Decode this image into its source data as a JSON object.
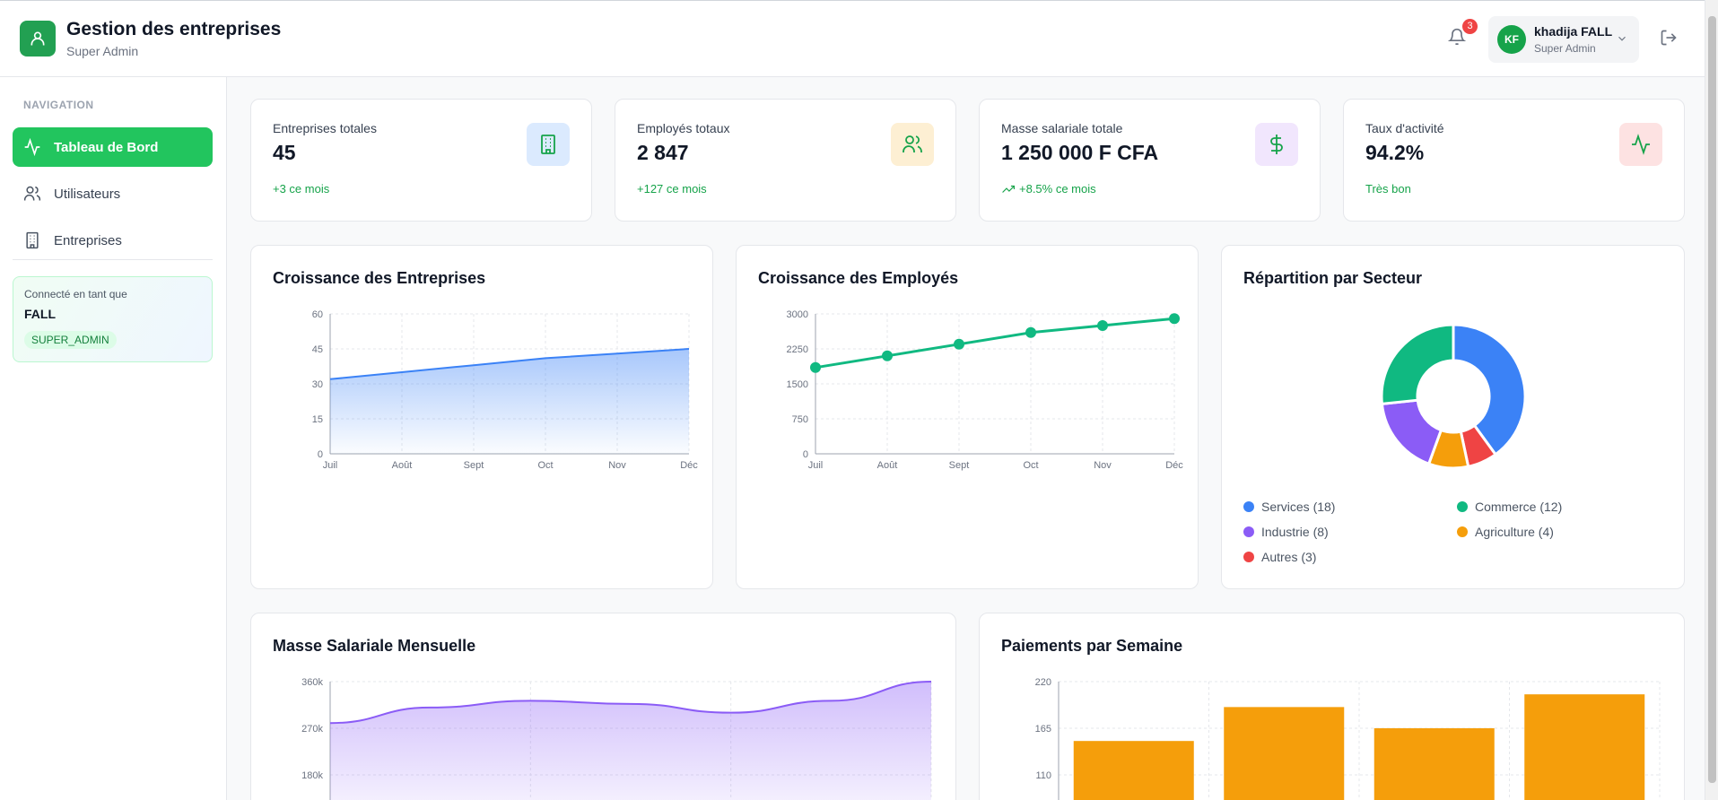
{
  "header": {
    "title": "Gestion des entreprises",
    "subtitle": "Super Admin",
    "notification_count": "3",
    "user": {
      "initials": "KF",
      "name": "khadija FALL",
      "role": "Super Admin"
    }
  },
  "sidebar": {
    "heading": "NAVIGATION",
    "items": [
      {
        "label": "Tableau de Bord",
        "icon": "activity-icon",
        "active": true
      },
      {
        "label": "Utilisateurs",
        "icon": "users-icon",
        "active": false
      },
      {
        "label": "Entreprises",
        "icon": "building-icon",
        "active": false
      }
    ],
    "connected": {
      "label": "Connecté en tant que",
      "name": "FALL",
      "role_badge": "SUPER_ADMIN"
    }
  },
  "stats": [
    {
      "label": "Entreprises totales",
      "value": "45",
      "delta": "+3 ce mois",
      "icon": "building-icon",
      "icon_bg": "#dbeafe",
      "icon_color": "#16a34a"
    },
    {
      "label": "Employés totaux",
      "value": "2 847",
      "delta": "+127 ce mois",
      "icon": "users-icon",
      "icon_bg": "#fdefd3",
      "icon_color": "#16a34a"
    },
    {
      "label": "Masse salariale totale",
      "value": "1 250 000 F CFA",
      "delta": "+8.5% ce mois",
      "icon": "dollar-icon",
      "icon_bg": "#f1e6fd",
      "icon_color": "#16a34a"
    },
    {
      "label": "Taux d'activité",
      "value": "94.2%",
      "delta": "Très bon",
      "icon": "activity-icon",
      "icon_bg": "#fde2e2",
      "icon_color": "#16a34a"
    }
  ],
  "charts": {
    "entreprises": {
      "title": "Croissance des Entreprises"
    },
    "employes": {
      "title": "Croissance des Employés"
    },
    "secteur": {
      "title": "Répartition par Secteur"
    },
    "masse": {
      "title": "Masse Salariale Mensuelle"
    },
    "paiements": {
      "title": "Paiements par Semaine"
    }
  },
  "chart_data": [
    {
      "type": "area",
      "title": "Croissance des Entreprises",
      "categories": [
        "Juil",
        "Août",
        "Sept",
        "Oct",
        "Nov",
        "Déc"
      ],
      "values": [
        32,
        35,
        38,
        41,
        43,
        45
      ],
      "ylim": [
        0,
        60
      ],
      "yticks": [
        "0",
        "15",
        "30",
        "45",
        "60"
      ],
      "color": "#3b82f6",
      "grid": true
    },
    {
      "type": "line",
      "title": "Croissance des Employés",
      "categories": [
        "Juil",
        "Août",
        "Sept",
        "Oct",
        "Nov",
        "Déc"
      ],
      "values": [
        1850,
        2100,
        2350,
        2600,
        2750,
        2900
      ],
      "ylim": [
        0,
        3000
      ],
      "yticks": [
        "0",
        "750",
        "1500",
        "2250",
        "3000"
      ],
      "color": "#10b981",
      "grid": true
    },
    {
      "type": "pie",
      "title": "Répartition par Secteur",
      "legend": "bottom",
      "slices": [
        {
          "name": "Services (18)",
          "value": 18,
          "color": "#3b82f6"
        },
        {
          "name": "Autres (3)",
          "value": 3,
          "color": "#ef4444"
        },
        {
          "name": "Agriculture (4)",
          "value": 4,
          "color": "#f59e0b"
        },
        {
          "name": "Industrie (8)",
          "value": 8,
          "color": "#8b5cf6"
        },
        {
          "name": "Commerce (12)",
          "value": 12,
          "color": "#10b981"
        }
      ]
    },
    {
      "type": "area",
      "title": "Masse Salariale Mensuelle",
      "values": [
        280000,
        310000,
        323000,
        317000,
        300000,
        323000,
        360000
      ],
      "ylim": [
        0,
        360000
      ],
      "yticks": [
        "360k",
        "270k",
        "180k"
      ],
      "color": "#8b5cf6",
      "grid": true
    },
    {
      "type": "bar",
      "title": "Paiements par Semaine",
      "values": [
        150,
        190,
        165,
        205
      ],
      "ylim": [
        0,
        220
      ],
      "yticks": [
        "220",
        "165",
        "110"
      ],
      "color": "#f59e0b",
      "grid": true
    }
  ]
}
